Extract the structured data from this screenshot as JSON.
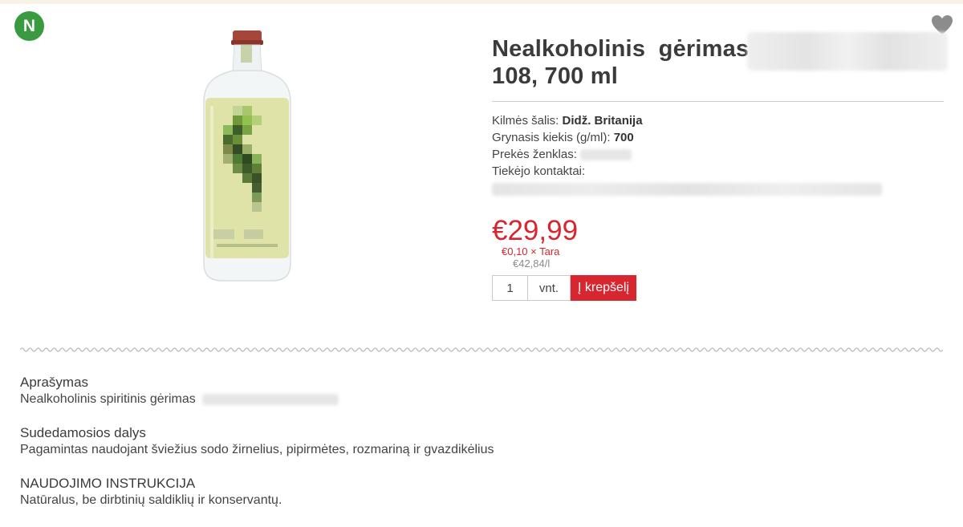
{
  "badge": {
    "label": "N",
    "color": "#3a9a3f"
  },
  "favorite": {
    "icon": "heart-icon"
  },
  "product": {
    "title_line1": "Nealkoholinis  gėrimas",
    "title_line2": "108, 700 ml",
    "specs": [
      {
        "label": "Kilmės šalis:",
        "value": "Didž. Britanija"
      },
      {
        "label": "Grynasis kiekis (g/ml):",
        "value": "700"
      },
      {
        "label": "Prekės ženklas:",
        "value": ""
      },
      {
        "label": "Tiekėjo kontaktai:",
        "value": ""
      }
    ],
    "price": "€29,99",
    "tara": "€0,10 × Tara",
    "unit_price": "€42,84/l",
    "accent_color": "#d7262f"
  },
  "cart": {
    "quantity": "1",
    "unit": "vnt.",
    "add_label": "Į krepšelį"
  },
  "description": {
    "sections": [
      {
        "heading": "Aprašymas",
        "text": "Nealkoholinis spiritinis gėrimas"
      },
      {
        "heading": "Sudedamosios dalys",
        "text": "Pagamintas naudojant šviežius sodo žirnelius, pipirmėtes, rozmariną ir gvazdikėlius"
      },
      {
        "heading": "NAUDOJIMO INSTRUKCIJA",
        "text": "Natūralus, be dirbtinių saldiklių ir konservantų."
      }
    ]
  }
}
